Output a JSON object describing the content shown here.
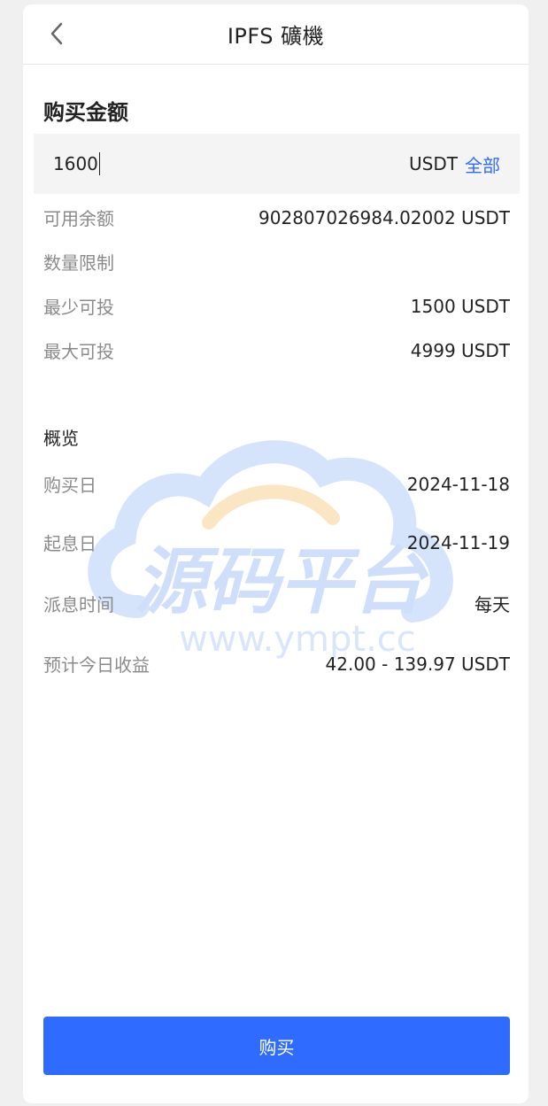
{
  "header": {
    "title": "IPFS 礦機",
    "back_icon": "chevron-left-icon"
  },
  "purchase": {
    "section_title": "购买金额",
    "amount_value": "1600",
    "currency": "USDT",
    "all_label": "全部"
  },
  "info": {
    "available_label": "可用余额",
    "available_value": "902807026984.02002 USDT",
    "limit_label": "数量限制",
    "min_label": "最少可投",
    "min_value": "1500 USDT",
    "max_label": "最大可投",
    "max_value": "4999 USDT"
  },
  "overview": {
    "title": "概览",
    "buy_date_label": "购买日",
    "buy_date_value": "2024-11-18",
    "interest_start_label": "起息日",
    "interest_start_value": "2024-11-19",
    "payout_label": "派息时间",
    "payout_value": "每天",
    "estimated_label": "预计今日收益",
    "estimated_value": "42.00 - 139.97 USDT"
  },
  "watermark": {
    "cn_text": "源码平台",
    "url_text": "www.ympt.cc"
  },
  "footer": {
    "buy_label": "购买"
  },
  "colors": {
    "accent": "#2f6bff",
    "label_gray": "#8a8a8a",
    "input_bg": "#f4f4f4"
  }
}
